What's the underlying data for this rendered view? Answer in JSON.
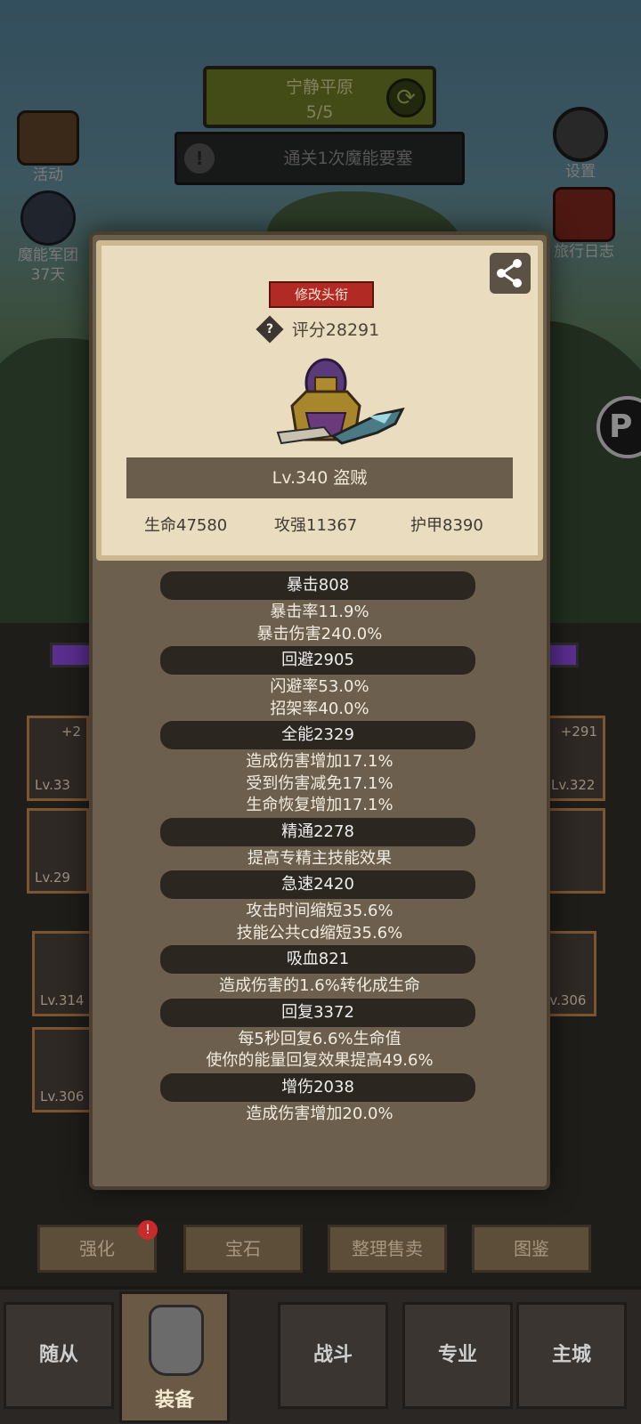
{
  "top_badge": {
    "title": "宁静平原",
    "progress": "5/5"
  },
  "quest": {
    "text": "通关1次魔能要塞"
  },
  "side_left": [
    {
      "label": "活动",
      "icon": "activity-scroll-icon"
    },
    {
      "label": "魔能军团",
      "sub": "37天",
      "icon": "legion-icon"
    }
  ],
  "side_right": [
    {
      "label": "设置",
      "icon": "gear-icon"
    },
    {
      "label": "旅行日志",
      "icon": "travel-log-icon"
    }
  ],
  "bg_slots": [
    {
      "lv": "Lv.33",
      "plus": "+2"
    },
    {
      "lv": "Lv.322",
      "plus": "+291"
    },
    {
      "lv": "Lv.29",
      "plus": ""
    },
    {
      "lv": "Lv.314",
      "plus": ""
    },
    {
      "lv": "Lv.306",
      "plus": ""
    },
    {
      "lv": "Lv.306",
      "plus": ""
    }
  ],
  "func_buttons": [
    "强化",
    "宝石",
    "整理售卖",
    "图鉴"
  ],
  "tabs": [
    "随从",
    "装备",
    "战斗",
    "专业",
    "主城"
  ],
  "card": {
    "title_button": "修改头衔",
    "score": "评分28291",
    "level_class": "Lv.340 盗贼",
    "hp": "生命47580",
    "atk": "攻强11367",
    "armor": "护甲8390"
  },
  "attributes": [
    {
      "head": "暴击808",
      "lines": [
        "暴击率11.9%",
        "暴击伤害240.0%"
      ]
    },
    {
      "head": "回避2905",
      "lines": [
        "闪避率53.0%",
        "招架率40.0%"
      ]
    },
    {
      "head": "全能2329",
      "lines": [
        "造成伤害增加17.1%",
        "受到伤害减免17.1%",
        "生命恢复增加17.1%"
      ]
    },
    {
      "head": "精通2278",
      "lines": [
        "提高专精主技能效果"
      ]
    },
    {
      "head": "急速2420",
      "lines": [
        "攻击时间缩短35.6%",
        "技能公共cd缩短35.6%"
      ]
    },
    {
      "head": "吸血821",
      "lines": [
        "造成伤害的1.6%转化成生命"
      ]
    },
    {
      "head": "回复3372",
      "lines": [
        "每5秒回复6.6%生命值",
        "使你的能量回复效果提高49.6%"
      ]
    },
    {
      "head": "增伤2038",
      "lines": [
        "造成伤害增加20.0%"
      ]
    }
  ],
  "colors": {
    "card_bg": "#eadcbe",
    "modal_bg": "#6d5f4d",
    "title_button": "#b22a24",
    "level_bar": "#6a5d4c"
  }
}
